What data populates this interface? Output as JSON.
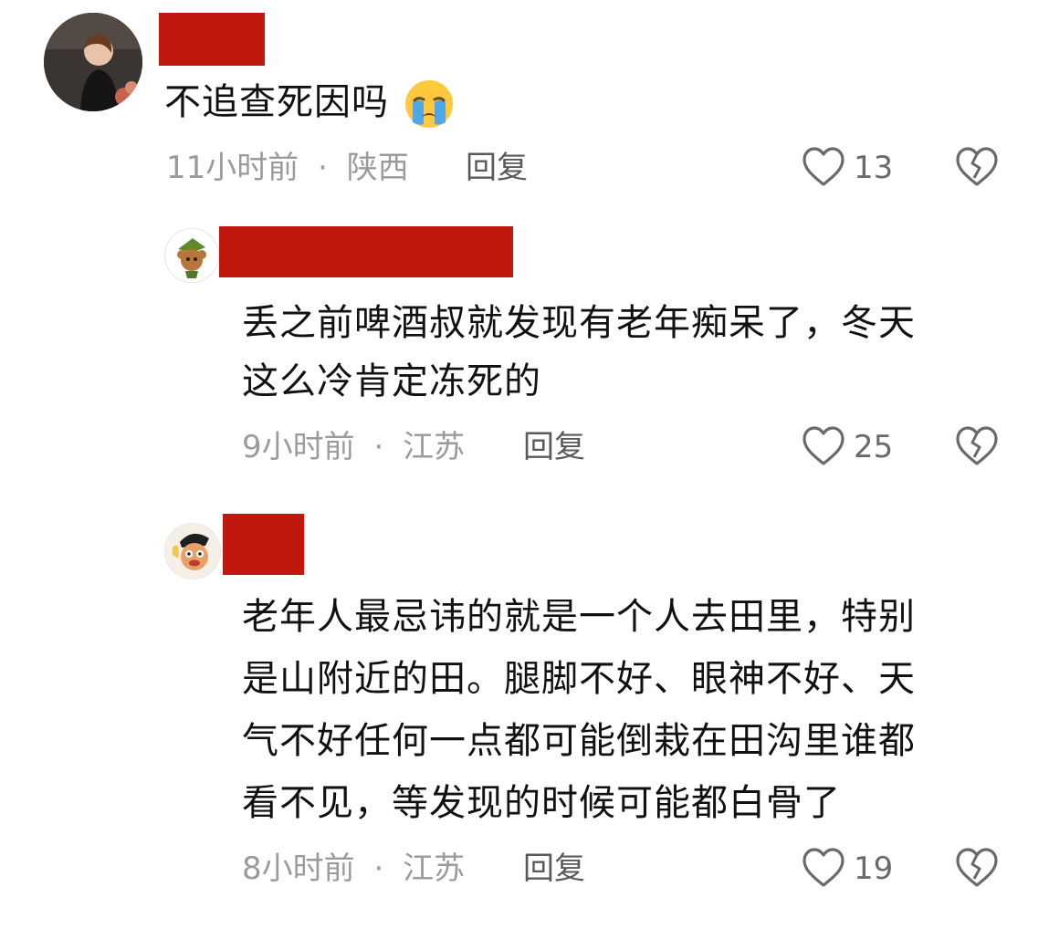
{
  "comments": [
    {
      "text": "不追查死因吗",
      "emoji": "crying-face-emoji",
      "time": "11小时前",
      "sep": "·",
      "location": "陕西",
      "reply_label": "回复",
      "likes": "13"
    },
    {
      "lines": [
        "丢之前啤酒叔就发现有老年痴呆了，冬天",
        "这么冷肯定冻死的"
      ],
      "time": "9小时前",
      "sep": "·",
      "location": "江苏",
      "reply_label": "回复",
      "likes": "25"
    },
    {
      "lines": [
        "老年人最忌讳的就是一个人去田里，特别",
        "是山附近的田。腿脚不好、眼神不好、天",
        "气不好任何一点都可能倒栽在田沟里谁都",
        "看不见，等发现的时候可能都白骨了"
      ],
      "time": "8小时前",
      "sep": "·",
      "location": "江苏",
      "reply_label": "回复",
      "likes": "19"
    }
  ],
  "colors": {
    "redaction": "#c0180f",
    "text": "#111111",
    "meta": "#9b9b9b",
    "icon": "#6a6a6a"
  }
}
